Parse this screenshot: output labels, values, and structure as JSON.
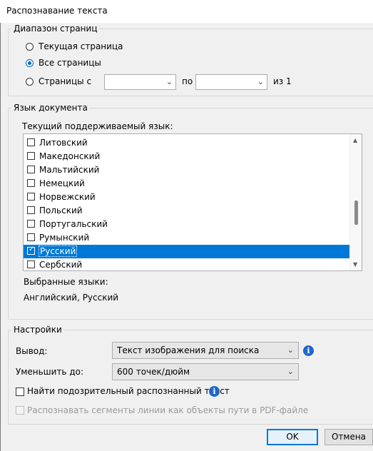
{
  "window": {
    "title": "Распознавание текста"
  },
  "page_range": {
    "legend": "Диапазон страниц",
    "current_page": "Текущая страница",
    "all_pages": "Все страницы",
    "pages_from": "Страницы с",
    "from_value": "",
    "to_label": "по",
    "to_value": "",
    "of_label": "из",
    "total": "1",
    "selected": "all_pages"
  },
  "language": {
    "legend": "Язык документа",
    "supported_label": "Текущий поддерживаемый язык:",
    "items": [
      {
        "label": "Литовский",
        "checked": false
      },
      {
        "label": "Македонский",
        "checked": false
      },
      {
        "label": "Мальтийский",
        "checked": false
      },
      {
        "label": "Немецкий",
        "checked": false
      },
      {
        "label": "Норвежский",
        "checked": false
      },
      {
        "label": "Польский",
        "checked": false
      },
      {
        "label": "Португальский",
        "checked": false
      },
      {
        "label": "Румынский",
        "checked": false
      },
      {
        "label": "Русский",
        "checked": true,
        "selected": true
      },
      {
        "label": "Сербский",
        "checked": false
      }
    ],
    "selected_label": "Выбранные языки:",
    "selected_value": "Английский, Русский"
  },
  "settings": {
    "legend": "Настройки",
    "output_label": "Вывод:",
    "output_value": "Текст изображения для поиска",
    "reduce_label": "Уменьшить до:",
    "reduce_value": "600 точек/дюйм",
    "find_suspicious": "Найти подозрительный распознанный текст",
    "find_suspicious_checked": false,
    "recognize_lines": "Распознавать сегменты линии как объекты пути в PDF-файле",
    "recognize_lines_enabled": false
  },
  "buttons": {
    "ok": "OK",
    "cancel": "Отмена"
  },
  "colors": {
    "accent": "#0078d7",
    "info": "#1e67c7"
  }
}
